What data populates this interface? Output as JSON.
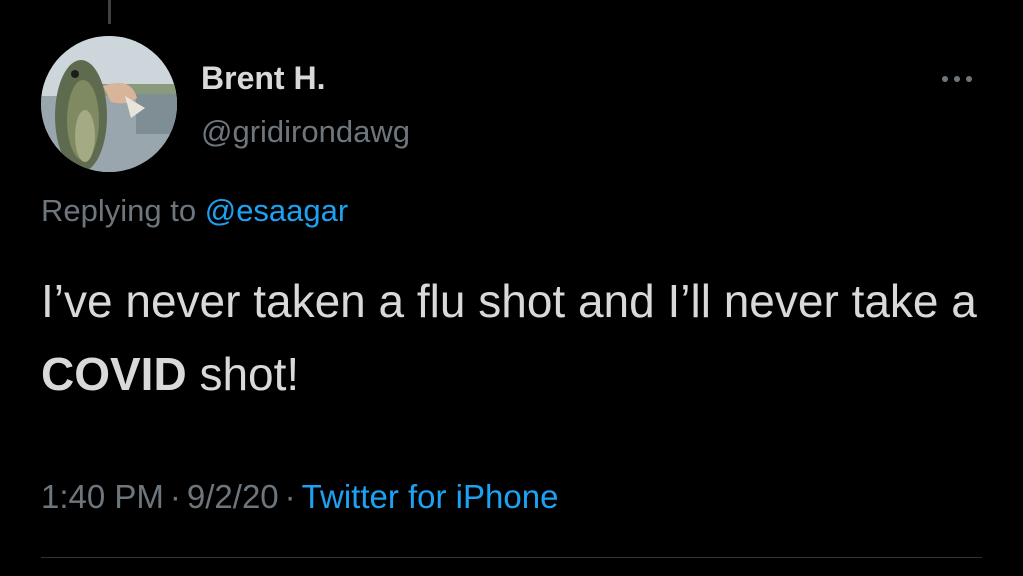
{
  "tweet": {
    "author": {
      "display_name": "Brent H.",
      "handle": "@gridirondawg",
      "avatar_icon": "avatar-fish-photo"
    },
    "more_icon": "more-horizontal-icon",
    "reply_prefix": "Replying to",
    "reply_to": "@esaagar",
    "text_before": "I’ve never taken a flu shot and I’ll never take a ",
    "text_bold": "COVID",
    "text_after": " shot!",
    "time": "1:40 PM",
    "separator": "·",
    "date": "9/2/20",
    "source": "Twitter for iPhone"
  },
  "colors": {
    "background": "#000000",
    "primary_text": "#d9d9d9",
    "secondary_text": "#6e767d",
    "link": "#1da1f2",
    "divider": "#2f3336"
  }
}
